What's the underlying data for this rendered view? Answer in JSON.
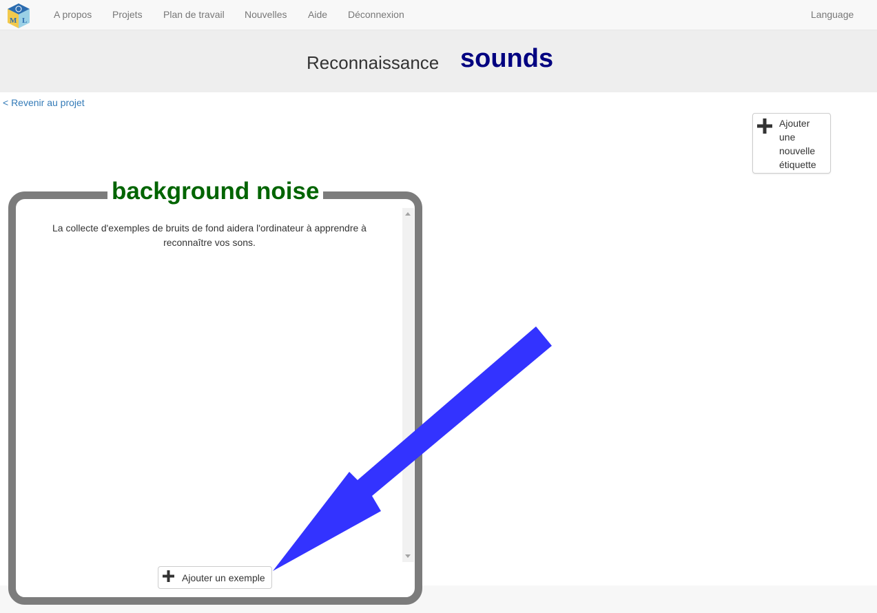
{
  "nav": {
    "items": [
      "A propos",
      "Projets",
      "Plan de travail",
      "Nouvelles",
      "Aide",
      "Déconnexion"
    ],
    "language": "Language",
    "logo_letters": [
      "M",
      "L"
    ]
  },
  "header": {
    "label": "Reconnaissance",
    "project": "sounds"
  },
  "back_link": "< Revenir au projet",
  "add_label_button": "Ajouter une nouvelle étiquette",
  "card": {
    "title": "background noise",
    "description": "La collecte d'exemples de bruits de fond aidera l'ordinateur à apprendre à reconnaître vos sons.",
    "add_example_button": "Ajouter un exemple"
  },
  "colors": {
    "project_title": "#000080",
    "card_title": "#006400",
    "card_border": "#7c7c7c",
    "arrow": "#3333ff",
    "link": "#337ab7"
  }
}
